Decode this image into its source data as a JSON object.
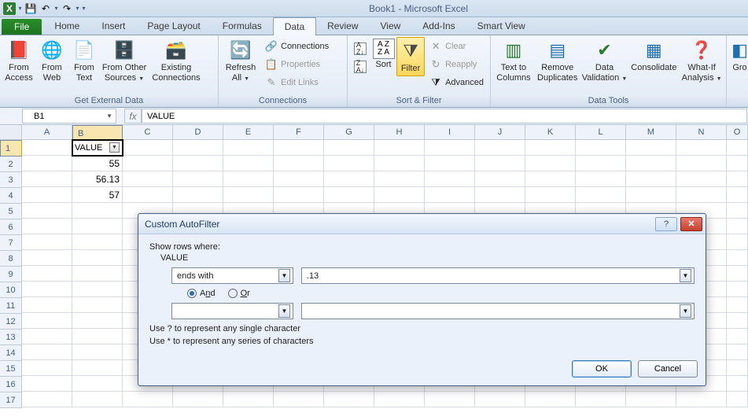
{
  "title": "Book1 - Microsoft Excel",
  "qat": {
    "excel": "X",
    "save": "💾",
    "undo": "↶",
    "redo": "↷"
  },
  "tabs": {
    "file": "File",
    "items": [
      "Home",
      "Insert",
      "Page Layout",
      "Formulas",
      "Data",
      "Review",
      "View",
      "Add-Ins",
      "Smart View"
    ],
    "active": "Data"
  },
  "ribbon": {
    "groups": {
      "ext": {
        "label": "Get External Data",
        "access": "From Access",
        "web": "From Web",
        "text": "From Text",
        "other": "From Other Sources",
        "existing": "Existing Connections"
      },
      "conn": {
        "label": "Connections",
        "refresh": "Refresh All",
        "connections": "Connections",
        "properties": "Properties",
        "editlinks": "Edit Links"
      },
      "sort": {
        "label": "Sort & Filter",
        "sort": "Sort",
        "filter": "Filter",
        "clear": "Clear",
        "reapply": "Reapply",
        "advanced": "Advanced"
      },
      "tools": {
        "label": "Data Tools",
        "ttc": "Text to Columns",
        "dup": "Remove Duplicates",
        "valid": "Data Validation",
        "cons": "Consolidate",
        "what": "What-If Analysis"
      },
      "outline": {
        "group": "Gro"
      }
    }
  },
  "fx": {
    "namebox": "B1",
    "label": "fx",
    "formula": "VALUE"
  },
  "sheet": {
    "cols": [
      "A",
      "B",
      "C",
      "D",
      "E",
      "F",
      "G",
      "H",
      "I",
      "J",
      "K",
      "L",
      "M",
      "N"
    ],
    "rows": [
      "1",
      "2",
      "3",
      "4",
      "5",
      "6",
      "7",
      "8",
      "9",
      "10",
      "11",
      "12",
      "13",
      "14",
      "15",
      "16",
      "17"
    ],
    "b1": "VALUE",
    "b2": "55",
    "b3": "56.13",
    "b4": "57"
  },
  "dialog": {
    "title": "Custom AutoFilter",
    "show_rows": "Show rows where:",
    "field": "VALUE",
    "op1": "ends with",
    "val1": ".13",
    "and_lbl_pre": "A",
    "and_lbl_und": "n",
    "and_lbl_post": "d",
    "or_lbl_und": "O",
    "or_lbl_post": "r",
    "op2": "",
    "val2": "",
    "hint1": "Use ? to represent any single character",
    "hint2": "Use * to represent any series of characters",
    "ok": "OK",
    "cancel": "Cancel"
  }
}
